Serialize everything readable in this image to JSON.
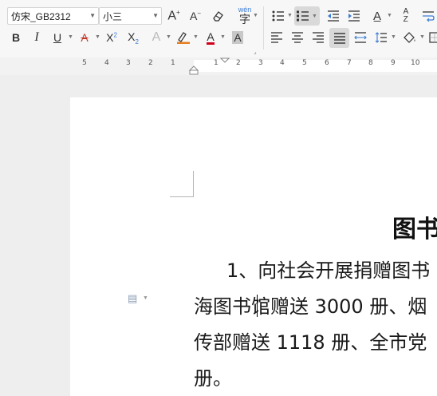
{
  "toolbar": {
    "font_family": "仿宋_GB2312",
    "font_size": "小三",
    "phonetic_label": "wén",
    "phonetic_char": "字",
    "icons": [
      "increase-font-size",
      "decrease-font-size",
      "clear-format",
      "phonetic-guide",
      "bullet-list",
      "numbered-list",
      "decrease-indent",
      "increase-indent",
      "text-direction",
      "sort",
      "line-wrap",
      "bold",
      "italic",
      "underline",
      "strikethrough",
      "superscript",
      "subscript",
      "text-effect",
      "highlight",
      "font-color",
      "char-shading",
      "align-left",
      "align-center",
      "align-right",
      "justify",
      "distributed",
      "line-spacing",
      "paragraph-shading",
      "borders"
    ],
    "bold": "B",
    "italic": "I",
    "underline": "U"
  },
  "ruler": {
    "left_numbers": [
      "5",
      "4",
      "3",
      "2",
      "1"
    ],
    "right_numbers": [
      "1",
      "2",
      "3",
      "4",
      "5",
      "6",
      "7",
      "8",
      "9",
      "10"
    ]
  },
  "document": {
    "title": "图书",
    "line1": "1、向社会开展捐赠图书",
    "line2": "海图书馆赠送 3000 册、烟",
    "line3": "传部赠送 1118 册、全市党",
    "line4": "册。"
  }
}
